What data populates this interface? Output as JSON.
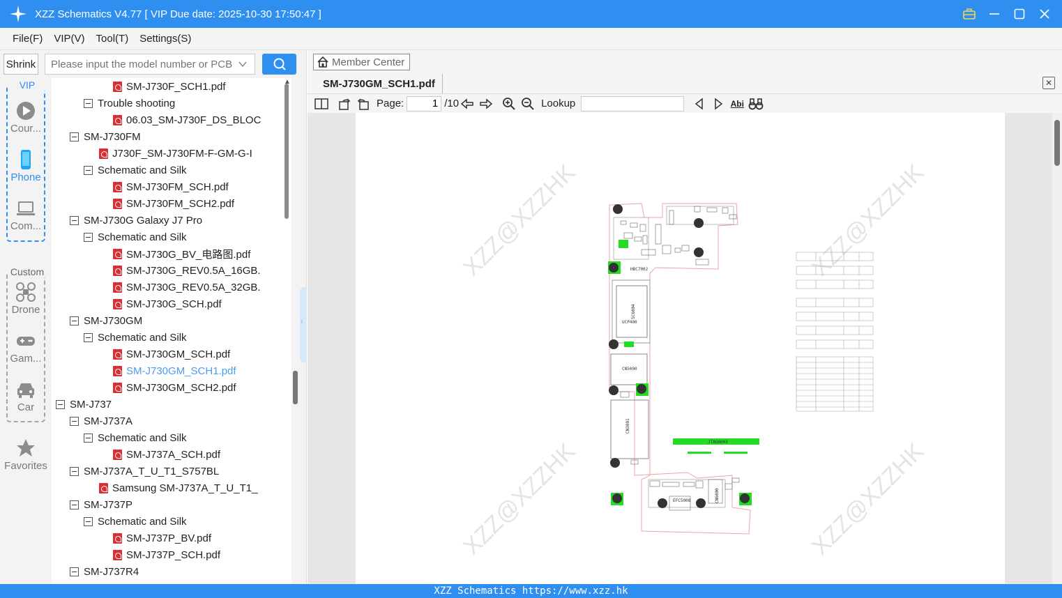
{
  "window": {
    "title": "XZZ Schematics V4.77 [ VIP Due date: 2025-10-30 17:50:47 ]"
  },
  "menu": [
    "File(F)",
    "VIP(V)",
    "Tool(T)",
    "Settings(S)"
  ],
  "search": {
    "shrink_label": "Shrink",
    "placeholder": "Please input the model number or PCB"
  },
  "categories": {
    "vip_label": "VIP",
    "custom_label": "Custom",
    "items": [
      {
        "label": "Cour...",
        "icon": "play-circle-icon"
      },
      {
        "label": "Phone",
        "icon": "phone-icon",
        "active": true
      },
      {
        "label": "Com...",
        "icon": "laptop-icon"
      },
      {
        "label": "Drone",
        "icon": "drone-icon"
      },
      {
        "label": "Gam...",
        "icon": "gamepad-icon"
      },
      {
        "label": "Car",
        "icon": "car-icon"
      }
    ],
    "favorites_label": "Favorites"
  },
  "tree": [
    {
      "label": "SM-J730F_SCH1.pdf",
      "type": "file",
      "level": 3
    },
    {
      "label": "Trouble shooting",
      "type": "folder",
      "level": 2
    },
    {
      "label": "06.03_SM-J730F_DS_BLOC",
      "type": "file",
      "level": 3
    },
    {
      "label": "SM-J730FM",
      "type": "folder",
      "level": 1
    },
    {
      "label": "J730F_SM-J730FM-F-GM-G-I",
      "type": "file",
      "level": 2
    },
    {
      "label": "Schematic and Silk",
      "type": "folder",
      "level": 2
    },
    {
      "label": "SM-J730FM_SCH.pdf",
      "type": "file",
      "level": 3
    },
    {
      "label": "SM-J730FM_SCH2.pdf",
      "type": "file",
      "level": 3
    },
    {
      "label": "SM-J730G Galaxy J7 Pro",
      "type": "folder",
      "level": 1
    },
    {
      "label": "Schematic and Silk",
      "type": "folder",
      "level": 2
    },
    {
      "label": "SM-J730G_BV_电路图.pdf",
      "type": "file",
      "level": 3
    },
    {
      "label": "SM-J730G_REV0.5A_16GB.",
      "type": "file",
      "level": 3
    },
    {
      "label": "SM-J730G_REV0.5A_32GB.",
      "type": "file",
      "level": 3
    },
    {
      "label": "SM-J730G_SCH.pdf",
      "type": "file",
      "level": 3
    },
    {
      "label": "SM-J730GM",
      "type": "folder",
      "level": 1
    },
    {
      "label": "Schematic and Silk",
      "type": "folder",
      "level": 2
    },
    {
      "label": "SM-J730GM_SCH.pdf",
      "type": "file",
      "level": 3
    },
    {
      "label": "SM-J730GM_SCH1.pdf",
      "type": "file",
      "level": 3,
      "selected": true
    },
    {
      "label": "SM-J730GM_SCH2.pdf",
      "type": "file",
      "level": 3
    },
    {
      "label": "SM-J737",
      "type": "folder",
      "level": 0
    },
    {
      "label": "SM-J737A",
      "type": "folder",
      "level": 1
    },
    {
      "label": "Schematic and Silk",
      "type": "folder",
      "level": 2
    },
    {
      "label": "SM-J737A_SCH.pdf",
      "type": "file",
      "level": 3
    },
    {
      "label": "SM-J737A_T_U_T1_S757BL",
      "type": "folder",
      "level": 1
    },
    {
      "label": "Samsung SM-J737A_T_U_T1_",
      "type": "file",
      "level": 2
    },
    {
      "label": "SM-J737P",
      "type": "folder",
      "level": 1
    },
    {
      "label": "Schematic and Silk",
      "type": "folder",
      "level": 2
    },
    {
      "label": "SM-J737P_BV.pdf",
      "type": "file",
      "level": 3
    },
    {
      "label": "SM-J737P_SCH.pdf",
      "type": "file",
      "level": 3
    },
    {
      "label": "SM-J737R4",
      "type": "folder",
      "level": 1
    }
  ],
  "viewer": {
    "member_center": "Member Center",
    "tab_title": "SM-J730GM_SCH1.pdf",
    "page_label": "Page:",
    "page_current": "1",
    "page_total": "/10",
    "lookup_label": "Lookup",
    "watermark": "XZZ@XZZHK",
    "board_labels": [
      "CN5000",
      "CN3001",
      "UCP400",
      "SC6004",
      "JTAG6003",
      "EFC5008",
      "CN6000",
      "HBC7002"
    ]
  },
  "status": {
    "text": "XZZ Schematics https://www.xzz.hk"
  },
  "colors": {
    "accent": "#2e8ff0",
    "pdf_icon": "#d93131",
    "selected_text": "#4a9df0",
    "board_green": "#22dd22"
  }
}
